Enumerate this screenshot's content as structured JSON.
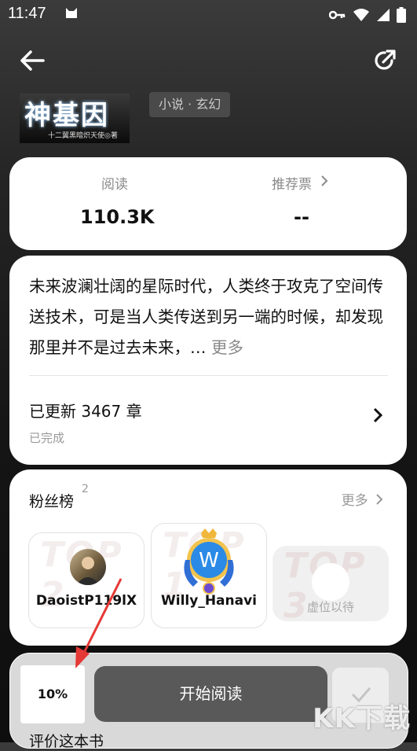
{
  "status_bar": {
    "time": "11:47"
  },
  "book": {
    "cover_title": "神基因",
    "cover_author": "十二翼黑暗炽天使◎著",
    "genre": "小说 · 玄幻"
  },
  "stats": {
    "reads_label": "阅读",
    "reads_value": "110.3K",
    "votes_label": "推荐票",
    "votes_value": "--"
  },
  "description": {
    "text": "未来波澜壮阔的星际时代，人类终于攻克了空间传送技术，可是当人类传送到另一端的时候，却发现那里并不是过去未来，…",
    "more_label": "更多",
    "chapters_label": "已更新 3467 章",
    "status_label": "已完成"
  },
  "fans": {
    "title": "粉丝榜",
    "count": "2",
    "more_label": "更多",
    "items": [
      {
        "rank_bg": "TOP 2",
        "name": "DaoistP119lX"
      },
      {
        "rank_bg": "TOP 1",
        "name": "Willy_Hanavi",
        "avatar_letter": "W"
      },
      {
        "rank_bg": "TOP 3",
        "name": "虚位以待"
      }
    ]
  },
  "bottom": {
    "progress": "10%",
    "read_button": "开始阅读",
    "review_label": "评价这本书"
  },
  "watermark": "KK下载"
}
